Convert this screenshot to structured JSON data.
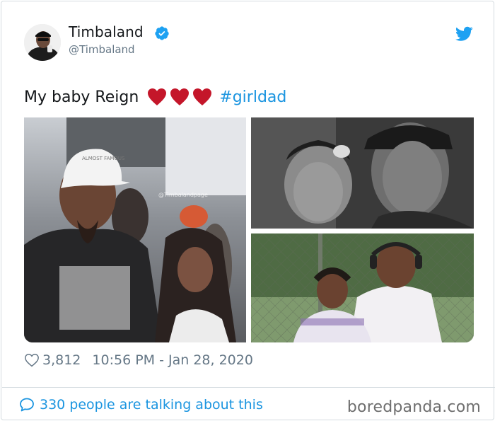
{
  "author": {
    "display_name": "Timbaland",
    "handle": "@Timbaland",
    "verified": true,
    "avatar_icon": "profile-photo"
  },
  "tweet": {
    "text": "My baby Reign",
    "emoji": [
      "red-heart",
      "red-heart",
      "red-heart"
    ],
    "hashtag": "#girldad",
    "images": [
      {
        "name": "photo-father-and-daughter-at-event",
        "watermark_text": "@Timbalandpage",
        "cap_text": "ALMOST FAMOUS"
      },
      {
        "name": "photo-black-and-white-closeup"
      },
      {
        "name": "photo-father-and-daughter-by-fence"
      }
    ]
  },
  "meta": {
    "like_count": "3,812",
    "timestamp": "10:56 PM - Jan 28, 2020"
  },
  "conversation": {
    "label": "330 people are talking about this"
  },
  "watermark": "boredpanda.com",
  "colors": {
    "link": "#1b95e0",
    "heart": "#c4162a",
    "secondary_text": "#657786",
    "border": "#d4dbe0"
  }
}
